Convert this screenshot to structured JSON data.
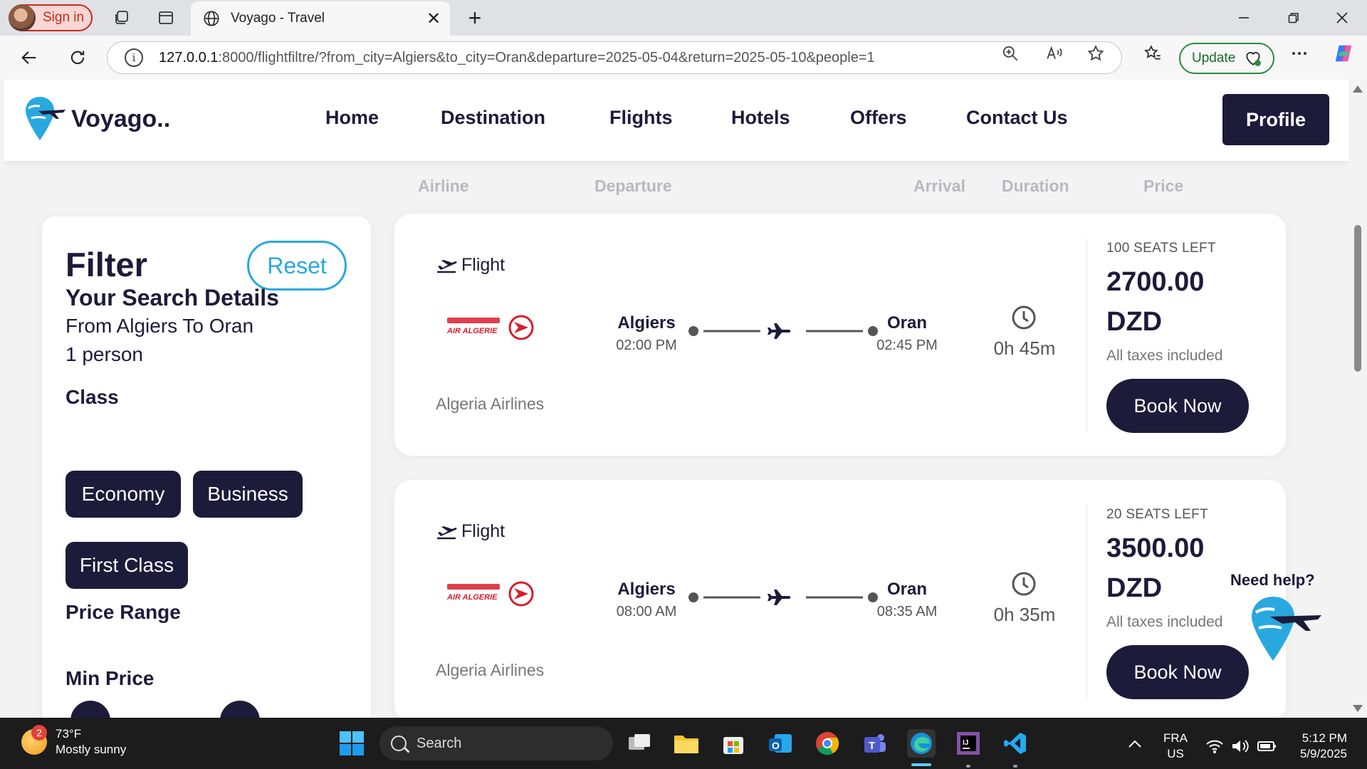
{
  "browser": {
    "signin_label": "Sign in",
    "tab_title": "Voyago - Travel",
    "url_host": "127.0.0.1",
    "url_rest": ":8000/flightfiltre/?from_city=Algiers&to_city=Oran&departure=2025-05-04&return=2025-05-10&people=1",
    "update_label": "Update"
  },
  "site": {
    "logo_text": "Voyago..",
    "nav": [
      "Home",
      "Destination",
      "Flights",
      "Hotels",
      "Offers",
      "Contact Us"
    ],
    "profile_label": "Profile"
  },
  "columns": [
    "Airline",
    "Departure",
    "Arrival",
    "Duration",
    "Price"
  ],
  "filter": {
    "title": "Filter",
    "reset_label": "Reset",
    "search_heading": "Your Search Details",
    "route_text": "From Algiers To Oran",
    "people_text": "1 person",
    "class_heading": "Class",
    "classes": [
      "Economy",
      "Business",
      "First Class"
    ],
    "price_range_heading": "Price Range",
    "min_price_heading": "Min Price"
  },
  "flights": [
    {
      "tag": "Flight",
      "airline": "Algeria Airlines",
      "logo_text": "AIR ALGERIE",
      "from_city": "Algiers",
      "dep_time": "02:00 PM",
      "to_city": "Oran",
      "arr_time": "02:45 PM",
      "duration": "0h 45m",
      "seats": "100 SEATS LEFT",
      "price": "2700.00",
      "currency": "DZD",
      "taxes": "All taxes included",
      "book_label": "Book Now"
    },
    {
      "tag": "Flight",
      "airline": "Algeria Airlines",
      "logo_text": "AIR ALGERIE",
      "from_city": "Algiers",
      "dep_time": "08:00 AM",
      "to_city": "Oran",
      "arr_time": "08:35 AM",
      "duration": "0h 35m",
      "seats": "20 SEATS LEFT",
      "price": "3500.00",
      "currency": "DZD",
      "taxes": "All taxes included",
      "book_label": "Book Now"
    }
  ],
  "help": {
    "label": "Need help?"
  },
  "taskbar": {
    "weather_badge": "2",
    "temperature": "73°F",
    "condition": "Mostly sunny",
    "search_label": "Search",
    "lang_top": "FRA",
    "lang_bottom": "US",
    "time": "5:12 PM",
    "date": "5/9/2025"
  },
  "colors": {
    "brand_navy": "#1d1b3a",
    "accent_blue": "#29a8e0",
    "airline_red": "#d81e2c",
    "update_green": "#2d8a3e"
  }
}
